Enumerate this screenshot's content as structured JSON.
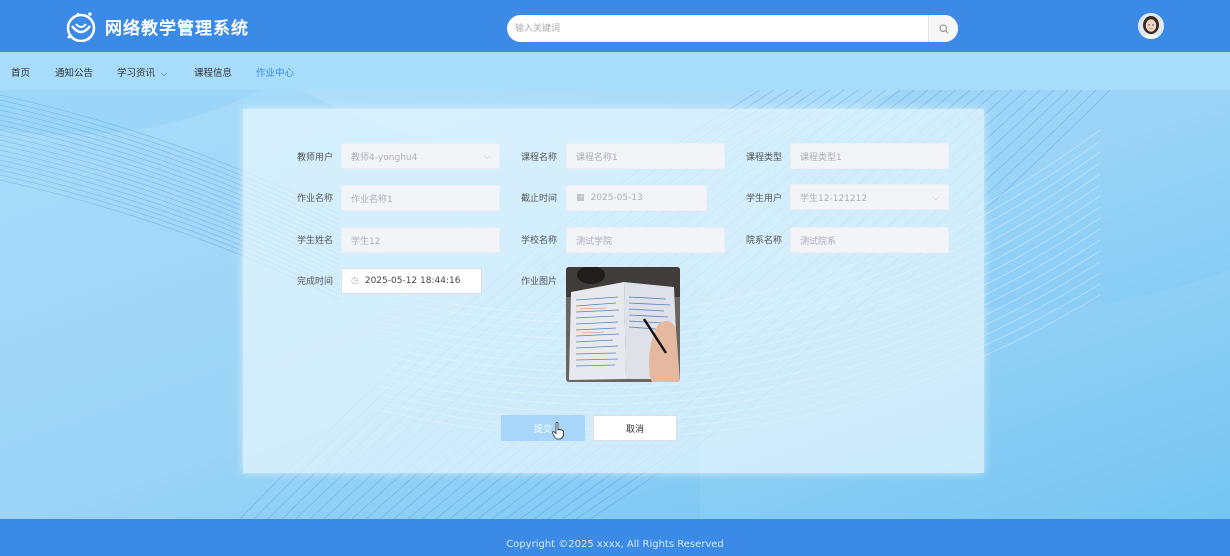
{
  "header": {
    "title": "网络教学管理系统",
    "search_placeholder": "输入关键词",
    "logo_icon": "smile-logo-icon",
    "search_icon": "search-icon",
    "avatar": "user-avatar"
  },
  "nav": {
    "items": [
      {
        "label": "首页"
      },
      {
        "label": "通知公告"
      },
      {
        "label": "学习资讯"
      },
      {
        "label": "课程信息"
      },
      {
        "label": "作业中心"
      }
    ],
    "active_index": 4
  },
  "form": {
    "teacher_user": {
      "label": "教师用户",
      "value": "教师4-yonghu4"
    },
    "course_name": {
      "label": "课程名称",
      "placeholder": "课程名称1"
    },
    "course_type": {
      "label": "课程类型",
      "placeholder": "课程类型1"
    },
    "homework_name": {
      "label": "作业名称",
      "placeholder": "作业名称1"
    },
    "deadline": {
      "label": "截止时间",
      "value": "2025-05-13"
    },
    "student_user": {
      "label": "学生用户",
      "value": "学生12-121212"
    },
    "student_name": {
      "label": "学生姓名",
      "placeholder": "学生12"
    },
    "school_name": {
      "label": "学校名称",
      "placeholder": "测试学院"
    },
    "department_name": {
      "label": "院系名称",
      "placeholder": "测试院系"
    },
    "completion_time": {
      "label": "完成时间",
      "value": "2025-05-12 18:44:16"
    },
    "homework_image": {
      "label": "作业图片"
    },
    "submit_label": "提交",
    "cancel_label": "取消"
  },
  "footer": {
    "copyright": "Copyright ©2025 xxxx, All Rights Reserved"
  },
  "colors": {
    "primary": "#3a8ae6",
    "nav_bg": "#a7dcfb",
    "active_nav": "#3a8ae6",
    "submit_bg": "#a8d6fb"
  }
}
